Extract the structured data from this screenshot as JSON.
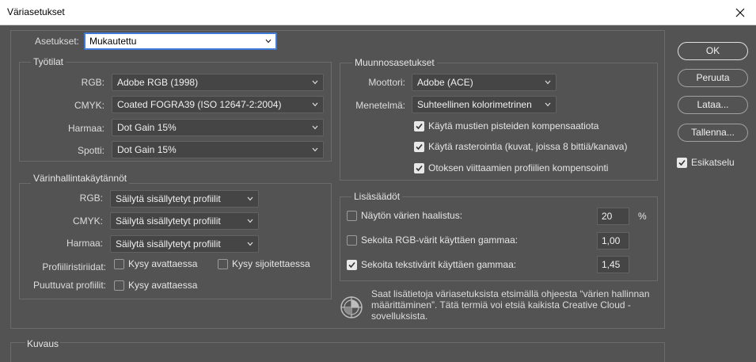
{
  "window": {
    "title": "Väriasetukset"
  },
  "settings": {
    "label": "Asetukset:",
    "value": "Mukautettu"
  },
  "workspaces": {
    "title": "Työtilat",
    "rgb": {
      "label": "RGB:",
      "value": "Adobe RGB (1998)"
    },
    "cmyk": {
      "label": "CMYK:",
      "value": "Coated FOGRA39 (ISO 12647-2:2004)"
    },
    "gray": {
      "label": "Harmaa:",
      "value": "Dot Gain 15%"
    },
    "spot": {
      "label": "Spotti:",
      "value": "Dot Gain 15%"
    }
  },
  "policies": {
    "title": "Värinhallintakäytännöt",
    "rgb": {
      "label": "RGB:",
      "value": "Säilytä sisällytetyt profiilit"
    },
    "cmyk": {
      "label": "CMYK:",
      "value": "Säilytä sisällytetyt profiilit"
    },
    "gray": {
      "label": "Harmaa:",
      "value": "Säilytä sisällytetyt profiilit"
    },
    "mismatch": {
      "label": "Profiiliristiriidat:",
      "ask_open": "Kysy avattaessa",
      "ask_paste": "Kysy sijoitettaessa"
    },
    "missing": {
      "label": "Puuttuvat profiilit:",
      "ask_open": "Kysy avattaessa"
    }
  },
  "conversion": {
    "title": "Muunnosasetukset",
    "engine": {
      "label": "Moottori:",
      "value": "Adobe (ACE)"
    },
    "intent": {
      "label": "Menetelmä:",
      "value": "Suhteellinen kolorimetrinen"
    },
    "black_point": "Käytä mustien pisteiden kompensaatiota",
    "dither": "Käytä rasterointia (kuvat, joissa 8 bittiä/kanava)",
    "scene_ref": "Otoksen viittaamien profiilien kompensointi"
  },
  "advanced": {
    "title": "Lisäsäädöt",
    "desaturate": {
      "label": "Näytön värien haalistus:",
      "value": "20",
      "unit": "%"
    },
    "blend_rgb": {
      "label": "Sekoita RGB-värit käyttäen gammaa:",
      "value": "1,00"
    },
    "blend_text": {
      "label": "Sekoita tekstivärit käyttäen gammaa:",
      "value": "1,45"
    }
  },
  "info": {
    "text": "Saat lisätietoja väriasetuksista etsimällä ohjeesta “värien hallinnan määrittäminen”. Tätä termiä voi etsiä kaikista Creative Cloud -sovelluksista."
  },
  "description": {
    "title": "Kuvaus"
  },
  "buttons": {
    "ok": "OK",
    "cancel": "Peruuta",
    "load": "Lataa...",
    "save": "Tallenna...",
    "preview": "Esikatselu"
  }
}
